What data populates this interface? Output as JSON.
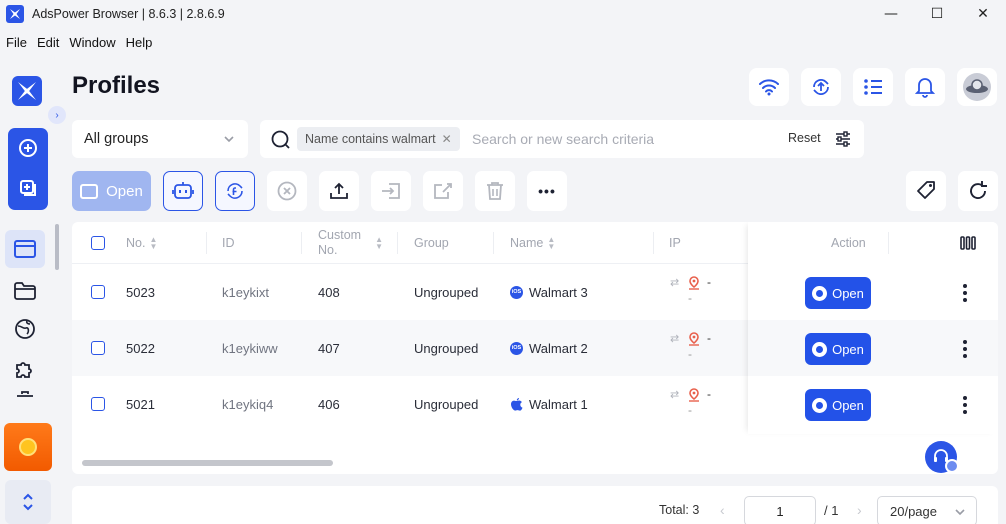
{
  "window": {
    "title": "AdsPower Browser | 8.6.3 | 2.8.6.9",
    "minimize": "—",
    "maximize": "☐",
    "close": "✕"
  },
  "menu": [
    "File",
    "Edit",
    "Window",
    "Help"
  ],
  "page": {
    "title": "Profiles"
  },
  "filters": {
    "group": "All groups",
    "chip": "Name contains walmart",
    "chip_close": "✕",
    "search_placeholder": "Search or new search criteria",
    "reset": "Reset"
  },
  "toolbar": {
    "open_label": "Open",
    "more": "•••"
  },
  "table": {
    "columns": {
      "no": "No.",
      "id": "ID",
      "custom_no_1": "Custom",
      "custom_no_2": "No.",
      "group": "Group",
      "name": "Name",
      "ip": "IP",
      "action": "Action"
    },
    "rows": [
      {
        "no": "5023",
        "id": "k1eykixt",
        "custom": "408",
        "group": "Ungrouped",
        "name": "Walmart 3",
        "os": "iOS",
        "ip_a": "-",
        "ip_b": "-",
        "action": "Open"
      },
      {
        "no": "5022",
        "id": "k1eykiww",
        "custom": "407",
        "group": "Ungrouped",
        "name": "Walmart 2",
        "os": "iOS",
        "ip_a": "-",
        "ip_b": "-",
        "action": "Open"
      },
      {
        "no": "5021",
        "id": "k1eykiq4",
        "custom": "406",
        "group": "Ungrouped",
        "name": "Walmart 1",
        "os": "mac",
        "ip_a": "-",
        "ip_b": "-",
        "action": "Open"
      }
    ]
  },
  "pagination": {
    "total": "Total: 3",
    "page": "1",
    "of": "/ 1",
    "page_size": "20/page",
    "prev": "‹",
    "next": "›"
  },
  "colors": {
    "accent": "#2b55e6",
    "open_disabled": "#a0b6f0",
    "promo": "#f25a00"
  }
}
